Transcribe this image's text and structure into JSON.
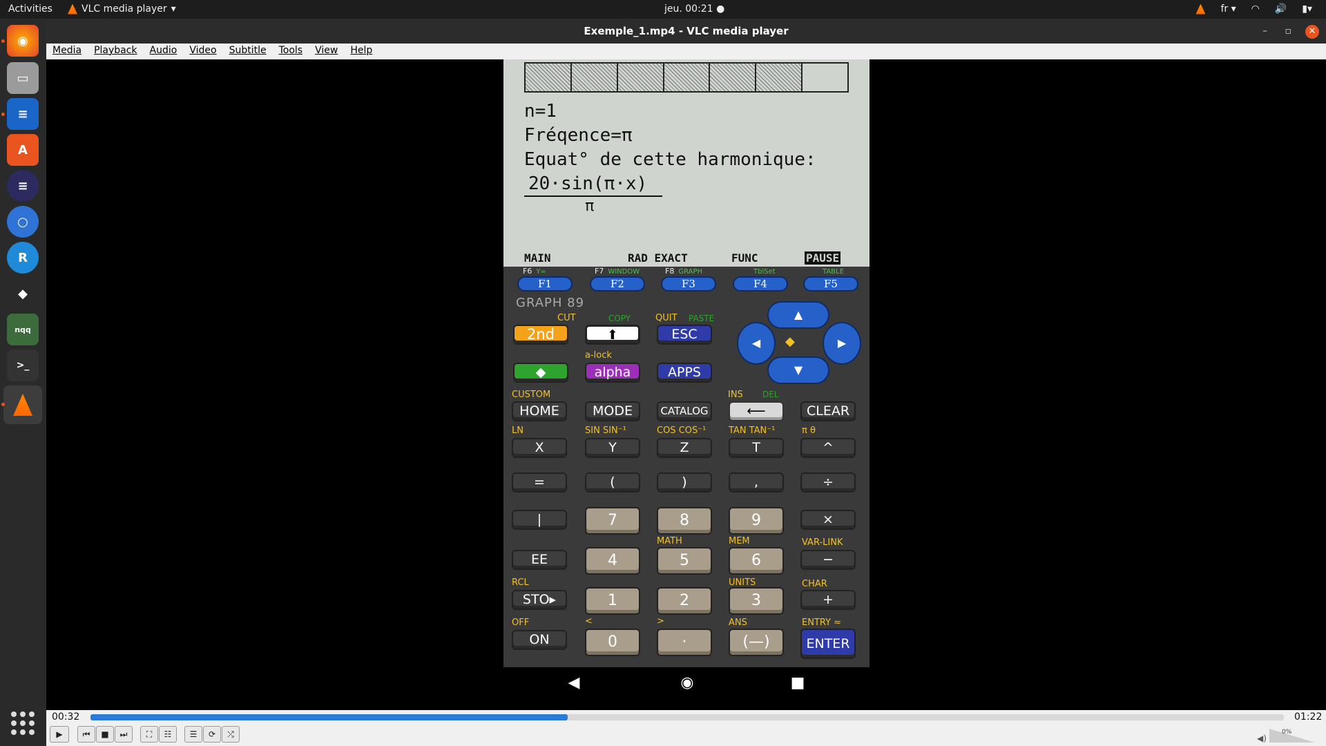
{
  "topbar": {
    "activities": "Activities",
    "app_name": "VLC media player",
    "clock": "jeu. 00:21 ●",
    "lang": "fr ▾"
  },
  "window": {
    "title": "Exemple_1.mp4 - VLC media player",
    "min": "–",
    "max": "▫",
    "close": "✕"
  },
  "menu": [
    "Media",
    "Playback",
    "Audio",
    "Video",
    "Subtitle",
    "Tools",
    "View",
    "Help"
  ],
  "calc": {
    "lines": [
      "n=1",
      "Fréqence=π",
      "Equat° de cette harmonique:",
      "20·sin(π·x)",
      "π"
    ],
    "status": [
      "MAIN",
      "RAD EXACT",
      "FUNC",
      "PAUSE"
    ],
    "fkeys": [
      {
        "label": "F1",
        "top": "F6",
        "top2": "Y="
      },
      {
        "label": "F2",
        "top": "F7",
        "top2": "WINDOW"
      },
      {
        "label": "F3",
        "top": "F8",
        "top2": "GRAPH"
      },
      {
        "label": "F4",
        "top": "",
        "top2": "TblSet"
      },
      {
        "label": "F5",
        "top": "",
        "top2": "TABLE"
      }
    ],
    "brand": "GRAPH 89",
    "row1": {
      "k2nd": "2nd",
      "shift": "⬆",
      "esc": "ESC",
      "cut": "CUT",
      "copy": "COPY",
      "quit": "QUIT",
      "paste": "PASTE"
    },
    "row2": {
      "diamond": "◆",
      "alpha": "alpha",
      "apps": "APPS",
      "alock": "a-lock"
    },
    "row3": {
      "home": "HOME",
      "mode": "MODE",
      "catalog": "CATALOG",
      "bksp": "⟵",
      "clear": "CLEAR",
      "custom": "CUSTOM",
      "ins": "INS",
      "del": "DEL"
    },
    "row4": [
      "X",
      "Y",
      "Z",
      "T",
      "^"
    ],
    "row4s": [
      "LN",
      "SIN  SIN⁻¹",
      "COS  COS⁻¹",
      "TAN  TAN⁻¹",
      "π   θ"
    ],
    "row5": [
      "=",
      "(",
      ")",
      ",",
      "÷"
    ],
    "row6": [
      "|",
      "7",
      "8",
      "9",
      "×"
    ],
    "row6s": [
      "",
      "",
      "",
      "",
      ""
    ],
    "row7": [
      "EE",
      "4",
      "5",
      "6",
      "−"
    ],
    "row7s": [
      "",
      "",
      "MATH",
      "MEM",
      "VAR-LINK"
    ],
    "row8": [
      "STO▸",
      "1",
      "2",
      "3",
      "+"
    ],
    "row8s": [
      "RCL",
      "",
      "",
      "UNITS",
      "CHAR"
    ],
    "row9": [
      "ON",
      "0",
      "·",
      "(—)",
      "ENTER"
    ],
    "row9s": [
      "OFF",
      "<",
      ">",
      "ANS",
      "ENTRY ≈"
    ]
  },
  "player": {
    "elapsed": "00:32",
    "total": "01:22",
    "progress": 0.4,
    "volume": "0%",
    "buttons": [
      "▶",
      "⏮",
      "■",
      "⏭",
      "⛶",
      "☷",
      "☰",
      "⟳",
      "⤮"
    ]
  },
  "colors": {
    "accent": "#e95420",
    "seek": "#2a7bd6",
    "fkey": "#2561c9",
    "second": "#f5a21b",
    "alpha": "#9b2fb8"
  }
}
